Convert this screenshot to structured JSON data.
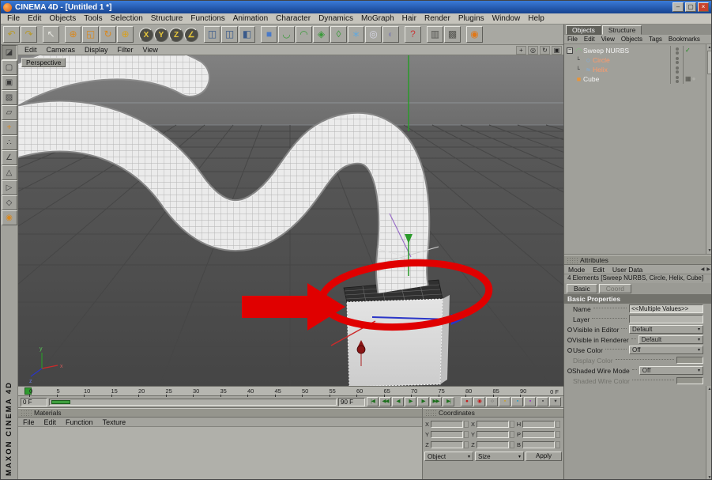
{
  "colors": {
    "annotation": "#e00000",
    "axis-x": "#cc2a2a",
    "axis-y": "#2a9a2a",
    "axis-z": "#2a35c8"
  },
  "icons": {
    "dropdown": "▾",
    "expander": "−",
    "scroll_up": "▲",
    "scroll_down": "▼"
  },
  "window": {
    "title": "CINEMA 4D - [Untitled 1 *]",
    "brand_vertical": "MAXON CINEMA 4D",
    "buttons": [
      {
        "name": "minimize-button",
        "glyph": "–"
      },
      {
        "name": "maximize-button",
        "glyph": "▢"
      },
      {
        "name": "close-button",
        "glyph": "×",
        "close": true
      }
    ]
  },
  "menubar": [
    "File",
    "Edit",
    "Objects",
    "Tools",
    "Selection",
    "Structure",
    "Functions",
    "Animation",
    "Character",
    "Dynamics",
    "MoGraph",
    "Hair",
    "Render",
    "Plugins",
    "Window",
    "Help"
  ],
  "toolbar": [
    {
      "name": "undo",
      "glyph": "↶",
      "color": "#b89a2a"
    },
    {
      "name": "redo",
      "glyph": "↷",
      "color": "#b89a2a"
    },
    {
      "name": "live-selection",
      "glyph": "↖",
      "color": "#e8e8e2",
      "sep": true
    },
    {
      "name": "move-tool",
      "glyph": "⊕",
      "color": "#d8881f",
      "sep": true
    },
    {
      "name": "scale-tool",
      "glyph": "◱",
      "color": "#d8881f"
    },
    {
      "name": "rotate-tool",
      "glyph": "↻",
      "color": "#d8881f"
    },
    {
      "name": "move-global-tool",
      "glyph": "⊕",
      "color": "#d8a01f"
    },
    {
      "name": "lock-x-axis",
      "glyph": "X",
      "color": "#e8c83a",
      "dark": true,
      "sep": true
    },
    {
      "name": "lock-y-axis",
      "glyph": "Y",
      "color": "#e8c83a",
      "dark": true
    },
    {
      "name": "lock-z-axis",
      "glyph": "Z",
      "color": "#e8c83a",
      "dark": true
    },
    {
      "name": "coordinate-system",
      "glyph": "∠",
      "color": "#e8c83a",
      "dark": true
    },
    {
      "name": "render-view",
      "glyph": "◫",
      "color": "#3a5a8a",
      "sep": true
    },
    {
      "name": "render-active-objects",
      "glyph": "◫",
      "color": "#3a5a8a"
    },
    {
      "name": "render-settings",
      "glyph": "◧",
      "color": "#3a5a8a"
    },
    {
      "name": "add-primitive",
      "glyph": "■",
      "color": "#4a7ac8",
      "sep": true
    },
    {
      "name": "add-spline",
      "glyph": "◡",
      "color": "#3a9a3a"
    },
    {
      "name": "add-nurbs",
      "glyph": "◠",
      "color": "#3a9a3a"
    },
    {
      "name": "add-modeling-object",
      "glyph": "◈",
      "color": "#3a9a3a"
    },
    {
      "name": "add-deformer",
      "glyph": "◊",
      "color": "#3a9a3a"
    },
    {
      "name": "add-particles",
      "glyph": "∗",
      "color": "#68a8d8"
    },
    {
      "name": "add-scene-object",
      "glyph": "◎",
      "color": "#d8d8e8"
    },
    {
      "name": "add-camera-light",
      "glyph": "◐",
      "color": "#8888aa"
    },
    {
      "name": "help",
      "glyph": "?",
      "color": "#c83a3a",
      "sep": true
    },
    {
      "name": "selection-filter",
      "glyph": "▥",
      "color": "#555550",
      "sep": true
    },
    {
      "name": "snap-settings",
      "glyph": "▩",
      "color": "#555550"
    },
    {
      "name": "mocca",
      "glyph": "◉",
      "color": "#e07818",
      "sep": true
    }
  ],
  "left_toolbar": [
    {
      "name": "make-editable",
      "glyph": "◪",
      "color": "#3a3a3a",
      "active": true
    },
    {
      "name": "model-mode",
      "glyph": "▢",
      "color": "#3a3a3a"
    },
    {
      "name": "texture-axis-mode",
      "glyph": "▣",
      "color": "#3a3a3a"
    },
    {
      "name": "texture-mode",
      "glyph": "▨",
      "color": "#3a3a3a"
    },
    {
      "name": "workplane-mode",
      "glyph": "▱",
      "color": "#3a3a3a"
    },
    {
      "name": "object-axis-mode",
      "glyph": "+",
      "color": "#d8881f"
    },
    {
      "name": "points-mode",
      "glyph": "∴",
      "color": "#3a3a3a"
    },
    {
      "name": "edges-mode",
      "glyph": "∠",
      "color": "#3a3a3a"
    },
    {
      "name": "polygons-mode",
      "glyph": "△",
      "color": "#3a3a3a"
    },
    {
      "name": "animation-mode",
      "glyph": "▷",
      "color": "#3a3a3a"
    },
    {
      "name": "viewport-solo-mode",
      "glyph": "◇",
      "color": "#3a3a3a"
    },
    {
      "name": "selection-brush",
      "glyph": "◉",
      "color": "#d8881f"
    }
  ],
  "viewport": {
    "label": "Perspective",
    "menu": [
      "Edit",
      "Cameras",
      "Display",
      "Filter",
      "View"
    ],
    "nav_icons": [
      {
        "name": "pan-view-icon",
        "glyph": "+"
      },
      {
        "name": "zoom-view-icon",
        "glyph": "◎"
      },
      {
        "name": "rotate-view-icon",
        "glyph": "↻"
      },
      {
        "name": "maximize-view-icon",
        "glyph": "▣"
      }
    ],
    "axis_labels": {
      "x": "x",
      "y": "y",
      "z": "z"
    }
  },
  "timeline": {
    "ticks": [
      "0",
      "5",
      "10",
      "15",
      "20",
      "25",
      "30",
      "35",
      "40",
      "45",
      "50",
      "55",
      "60",
      "65",
      "70",
      "75",
      "80",
      "85",
      "90"
    ],
    "right_label": "0 F",
    "start_field": "0 F",
    "end_field": "90 F",
    "transport": [
      {
        "name": "goto-start-button",
        "glyph": "|◀",
        "color": "#1c6e1c"
      },
      {
        "name": "previous-key-button",
        "glyph": "◀◀",
        "color": "#1c6e1c"
      },
      {
        "name": "previous-frame-button",
        "glyph": "◀",
        "color": "#1c6e1c"
      },
      {
        "name": "play-forward-button",
        "glyph": "▶",
        "color": "#1c6e1c"
      },
      {
        "name": "next-frame-button",
        "glyph": "▶",
        "color": "#1c6e1c"
      },
      {
        "name": "next-key-button",
        "glyph": "▶▶",
        "color": "#1c6e1c"
      },
      {
        "name": "goto-end-button",
        "glyph": "▶|",
        "color": "#1c6e1c"
      }
    ],
    "record": [
      {
        "name": "record-keyframe-button",
        "glyph": "●",
        "color": "#c41c1c"
      },
      {
        "name": "autokeying-button",
        "glyph": "◉",
        "color": "#c41c1c"
      },
      {
        "name": "keyframe-selection-button",
        "glyph": "○",
        "color": "#3a3a3a"
      },
      {
        "name": "record-position-button",
        "glyph": "▪",
        "color": "#caa020"
      },
      {
        "name": "record-scale-button",
        "glyph": "▪",
        "color": "#20a0ca"
      },
      {
        "name": "record-rotation-button",
        "glyph": "▪",
        "color": "#9a20ca"
      },
      {
        "name": "record-parameter-button",
        "glyph": "▪",
        "color": "#3a3a3a"
      },
      {
        "name": "playback-options-button",
        "glyph": "▾",
        "color": "#3a3a3a"
      }
    ]
  },
  "materials": {
    "title": "Materials",
    "menu": [
      "File",
      "Edit",
      "Function",
      "Texture"
    ]
  },
  "coordinates": {
    "title": "Coordinates",
    "groups": [
      {
        "name": "position",
        "labels": [
          "X",
          "Y",
          "Z"
        ],
        "values": [
          "",
          "",
          ""
        ]
      },
      {
        "name": "size",
        "labels": [
          "X",
          "Y",
          "Z"
        ],
        "values": [
          "",
          "",
          ""
        ]
      },
      {
        "name": "rotation",
        "labels": [
          "H",
          "P",
          "B"
        ],
        "values": [
          "",
          "",
          ""
        ]
      }
    ],
    "mode_dropdown": "Object",
    "size_dropdown": "Size",
    "apply_label": "Apply"
  },
  "object_manager": {
    "tabs": [
      {
        "label": "Objects",
        "active": true
      },
      {
        "label": "Structure",
        "active": false
      }
    ],
    "menu": [
      "File",
      "Edit",
      "View",
      "Objects",
      "Tags",
      "Bookmarks"
    ],
    "tree": [
      {
        "name": "Sweep NURBS",
        "level": 0,
        "children": true,
        "icon": "sweep-nurbs",
        "glyph": "◠",
        "icon_color": "#79c879",
        "color": "#f4f4f4",
        "tags": [
          {
            "name": "enabled-check-icon",
            "glyph": "✓",
            "color": "#1c8a1c"
          }
        ]
      },
      {
        "name": "Circle",
        "level": 1,
        "children": false,
        "icon": "circle-spline",
        "glyph": "○",
        "icon_color": "#7ab0e8",
        "color": "#ff9a6a",
        "tags": []
      },
      {
        "name": "Helix",
        "level": 1,
        "children": false,
        "icon": "helix-spline",
        "glyph": "≈",
        "icon_color": "#7ab0e8",
        "color": "#ff9a6a",
        "tags": []
      },
      {
        "name": "Cube",
        "level": 0,
        "children": false,
        "icon": "cube",
        "glyph": "■",
        "icon_color": "#e8953a",
        "color": "#f4f4f4",
        "tags": [
          {
            "name": "texture-tag-icon",
            "glyph": "▦",
            "color": "#50504a"
          },
          {
            "name": "phong-tag-icon",
            "glyph": "●",
            "color": "#b0b0aa"
          }
        ]
      }
    ]
  },
  "attributes": {
    "title": "Attributes",
    "menu": [
      "Mode",
      "Edit",
      "User Data"
    ],
    "nav": [
      {
        "name": "history-back-icon",
        "glyph": "◀"
      },
      {
        "name": "history-forward-icon",
        "glyph": "▶"
      }
    ],
    "info": "4 Elements [Sweep NURBS, Circle, Helix, Cube]",
    "tabs": [
      {
        "label": "Basic",
        "active": true
      },
      {
        "label": "Coord",
        "active": false,
        "disabled": true
      }
    ],
    "section": "Basic Properties",
    "rows": [
      {
        "label": "Name",
        "type": "input",
        "value": "<<Multiple Values>>",
        "anim": false
      },
      {
        "label": "Layer",
        "type": "layer",
        "value": "",
        "anim": false
      },
      {
        "label": "Visible in Editor",
        "type": "dropdown",
        "value": "Default",
        "anim": true
      },
      {
        "label": "Visible in Renderer",
        "type": "dropdown",
        "value": "Default",
        "anim": true
      },
      {
        "label": "Use Color",
        "type": "dropdown",
        "value": "Off",
        "anim": true
      },
      {
        "label": "Display Color",
        "type": "color",
        "value": "",
        "anim": false,
        "disabled": true
      },
      {
        "label": "Shaded Wire Mode",
        "type": "dropdown",
        "value": "Off",
        "anim": true
      },
      {
        "label": "Shaded Wire Color",
        "type": "color",
        "value": "",
        "anim": false,
        "disabled": true
      }
    ]
  }
}
